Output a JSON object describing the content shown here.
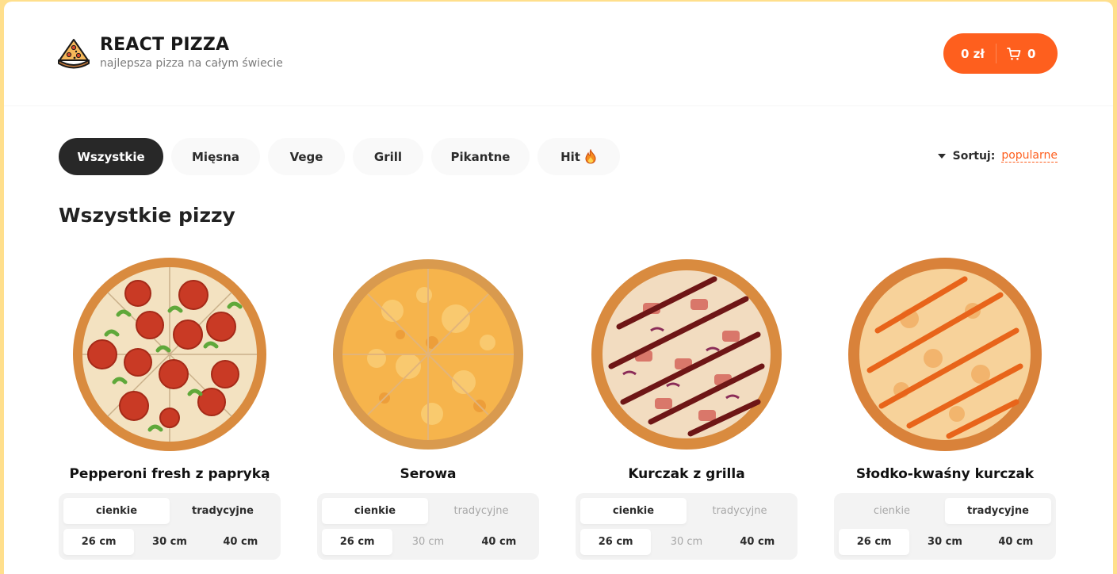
{
  "header": {
    "title": "REACT PIZZA",
    "subtitle": "najlepsza pizza na całym świecie",
    "cart": {
      "price": "0 zł",
      "count": "0",
      "icon": "cart-icon"
    }
  },
  "categories": [
    {
      "label": "Wszystkie",
      "active": true
    },
    {
      "label": "Mięsna",
      "active": false
    },
    {
      "label": "Vege",
      "active": false
    },
    {
      "label": "Grill",
      "active": false
    },
    {
      "label": "Pikantne",
      "active": false
    },
    {
      "label": "Hit",
      "active": false,
      "icon": "fire-icon"
    }
  ],
  "sort": {
    "label": "Sortuj:",
    "value": "popularne"
  },
  "section_title": "Wszystkie pizzy",
  "pizzas": [
    {
      "name": "Pepperoni fresh z papryką",
      "types": [
        {
          "label": "cienkie",
          "state": "active"
        },
        {
          "label": "tradycyjne",
          "state": "normal"
        }
      ],
      "sizes": [
        {
          "label": "26 cm",
          "state": "active"
        },
        {
          "label": "30 cm",
          "state": "normal"
        },
        {
          "label": "40 cm",
          "state": "normal"
        }
      ]
    },
    {
      "name": "Serowa",
      "types": [
        {
          "label": "cienkie",
          "state": "active"
        },
        {
          "label": "tradycyjne",
          "state": "disabled"
        }
      ],
      "sizes": [
        {
          "label": "26 cm",
          "state": "active"
        },
        {
          "label": "30 cm",
          "state": "disabled"
        },
        {
          "label": "40 cm",
          "state": "normal"
        }
      ]
    },
    {
      "name": "Kurczak z grilla",
      "types": [
        {
          "label": "cienkie",
          "state": "active"
        },
        {
          "label": "tradycyjne",
          "state": "disabled"
        }
      ],
      "sizes": [
        {
          "label": "26 cm",
          "state": "active"
        },
        {
          "label": "30 cm",
          "state": "disabled"
        },
        {
          "label": "40 cm",
          "state": "normal"
        }
      ]
    },
    {
      "name": "Słodko-kwaśny kurczak",
      "types": [
        {
          "label": "cienkie",
          "state": "disabled"
        },
        {
          "label": "tradycyjne",
          "state": "active"
        }
      ],
      "sizes": [
        {
          "label": "26 cm",
          "state": "active"
        },
        {
          "label": "30 cm",
          "state": "normal"
        },
        {
          "label": "40 cm",
          "state": "normal"
        }
      ]
    }
  ],
  "colors": {
    "accent": "#fe5f1e",
    "active_category": "#282828",
    "page_bg": "#ffdf8c"
  }
}
